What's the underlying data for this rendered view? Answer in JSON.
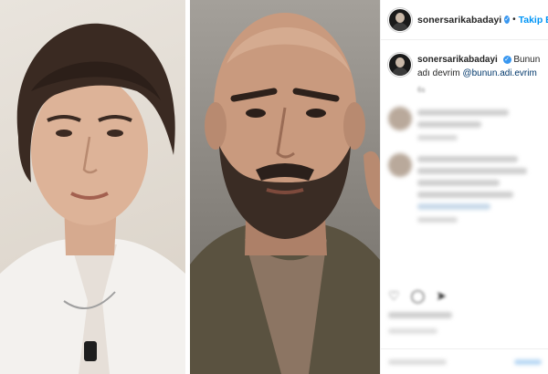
{
  "post": {
    "username": "sonersarikabadayi",
    "separator": "•",
    "follow_label": "Takip Et",
    "verified_icon": "verified-badge-icon",
    "caption_username": "sonersarikabadayi",
    "caption_text": "Bunun adı devrim",
    "caption_mention": "@bunun.adi.evrim",
    "caption_time": "6s"
  },
  "colors": {
    "accent": "#0095f6",
    "verified": "#3897f0",
    "mention": "#00376b",
    "border": "#efefef"
  },
  "actions": {
    "icons": [
      "heart-icon",
      "comment-icon",
      "share-icon"
    ]
  }
}
